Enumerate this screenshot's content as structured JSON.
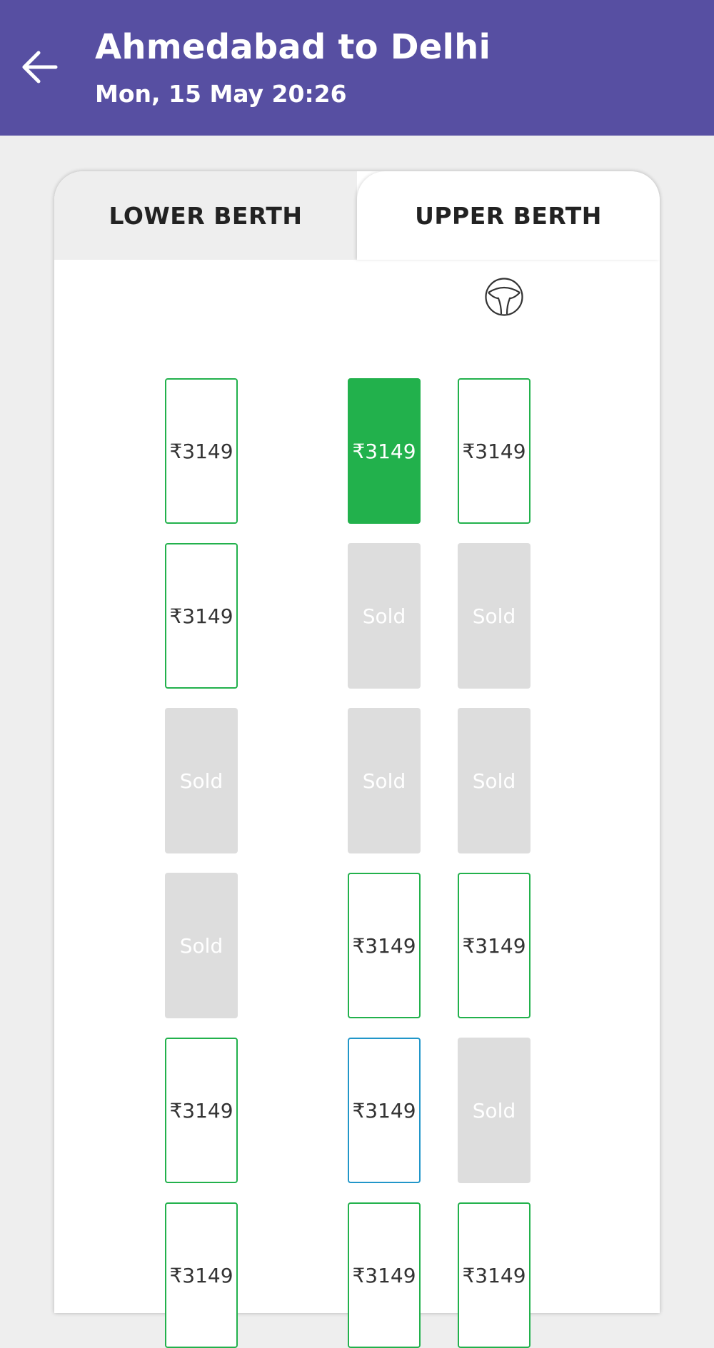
{
  "header": {
    "title": "Ahmedabad to Delhi",
    "subtitle": "Mon, 15 May 20:26",
    "background_color": "#574fa2",
    "back_icon": "arrow-left-icon"
  },
  "tabs": [
    {
      "label": "LOWER BERTH",
      "active": false
    },
    {
      "label": "UPPER BERTH",
      "active": true
    }
  ],
  "steering_icon": "steering-wheel-icon",
  "colors": {
    "available_border": "#22b14c",
    "selected_fill": "#22b14c",
    "sold_fill": "#dddddd",
    "reserved_border": "#2196c9"
  },
  "seat_rows": [
    [
      {
        "label": "₹3149",
        "status": "available"
      },
      {
        "label": "₹3149",
        "status": "selected"
      },
      {
        "label": "₹3149",
        "status": "available"
      }
    ],
    [
      {
        "label": "₹3149",
        "status": "available"
      },
      {
        "label": "Sold",
        "status": "sold"
      },
      {
        "label": "Sold",
        "status": "sold"
      }
    ],
    [
      {
        "label": "Sold",
        "status": "sold"
      },
      {
        "label": "Sold",
        "status": "sold"
      },
      {
        "label": "Sold",
        "status": "sold"
      }
    ],
    [
      {
        "label": "Sold",
        "status": "sold"
      },
      {
        "label": "₹3149",
        "status": "available"
      },
      {
        "label": "₹3149",
        "status": "available"
      }
    ],
    [
      {
        "label": "₹3149",
        "status": "available"
      },
      {
        "label": "₹3149",
        "status": "reserved"
      },
      {
        "label": "Sold",
        "status": "sold"
      }
    ],
    [
      {
        "label": "₹3149",
        "status": "available"
      },
      {
        "label": "₹3149",
        "status": "available"
      },
      {
        "label": "₹3149",
        "status": "available"
      }
    ]
  ]
}
